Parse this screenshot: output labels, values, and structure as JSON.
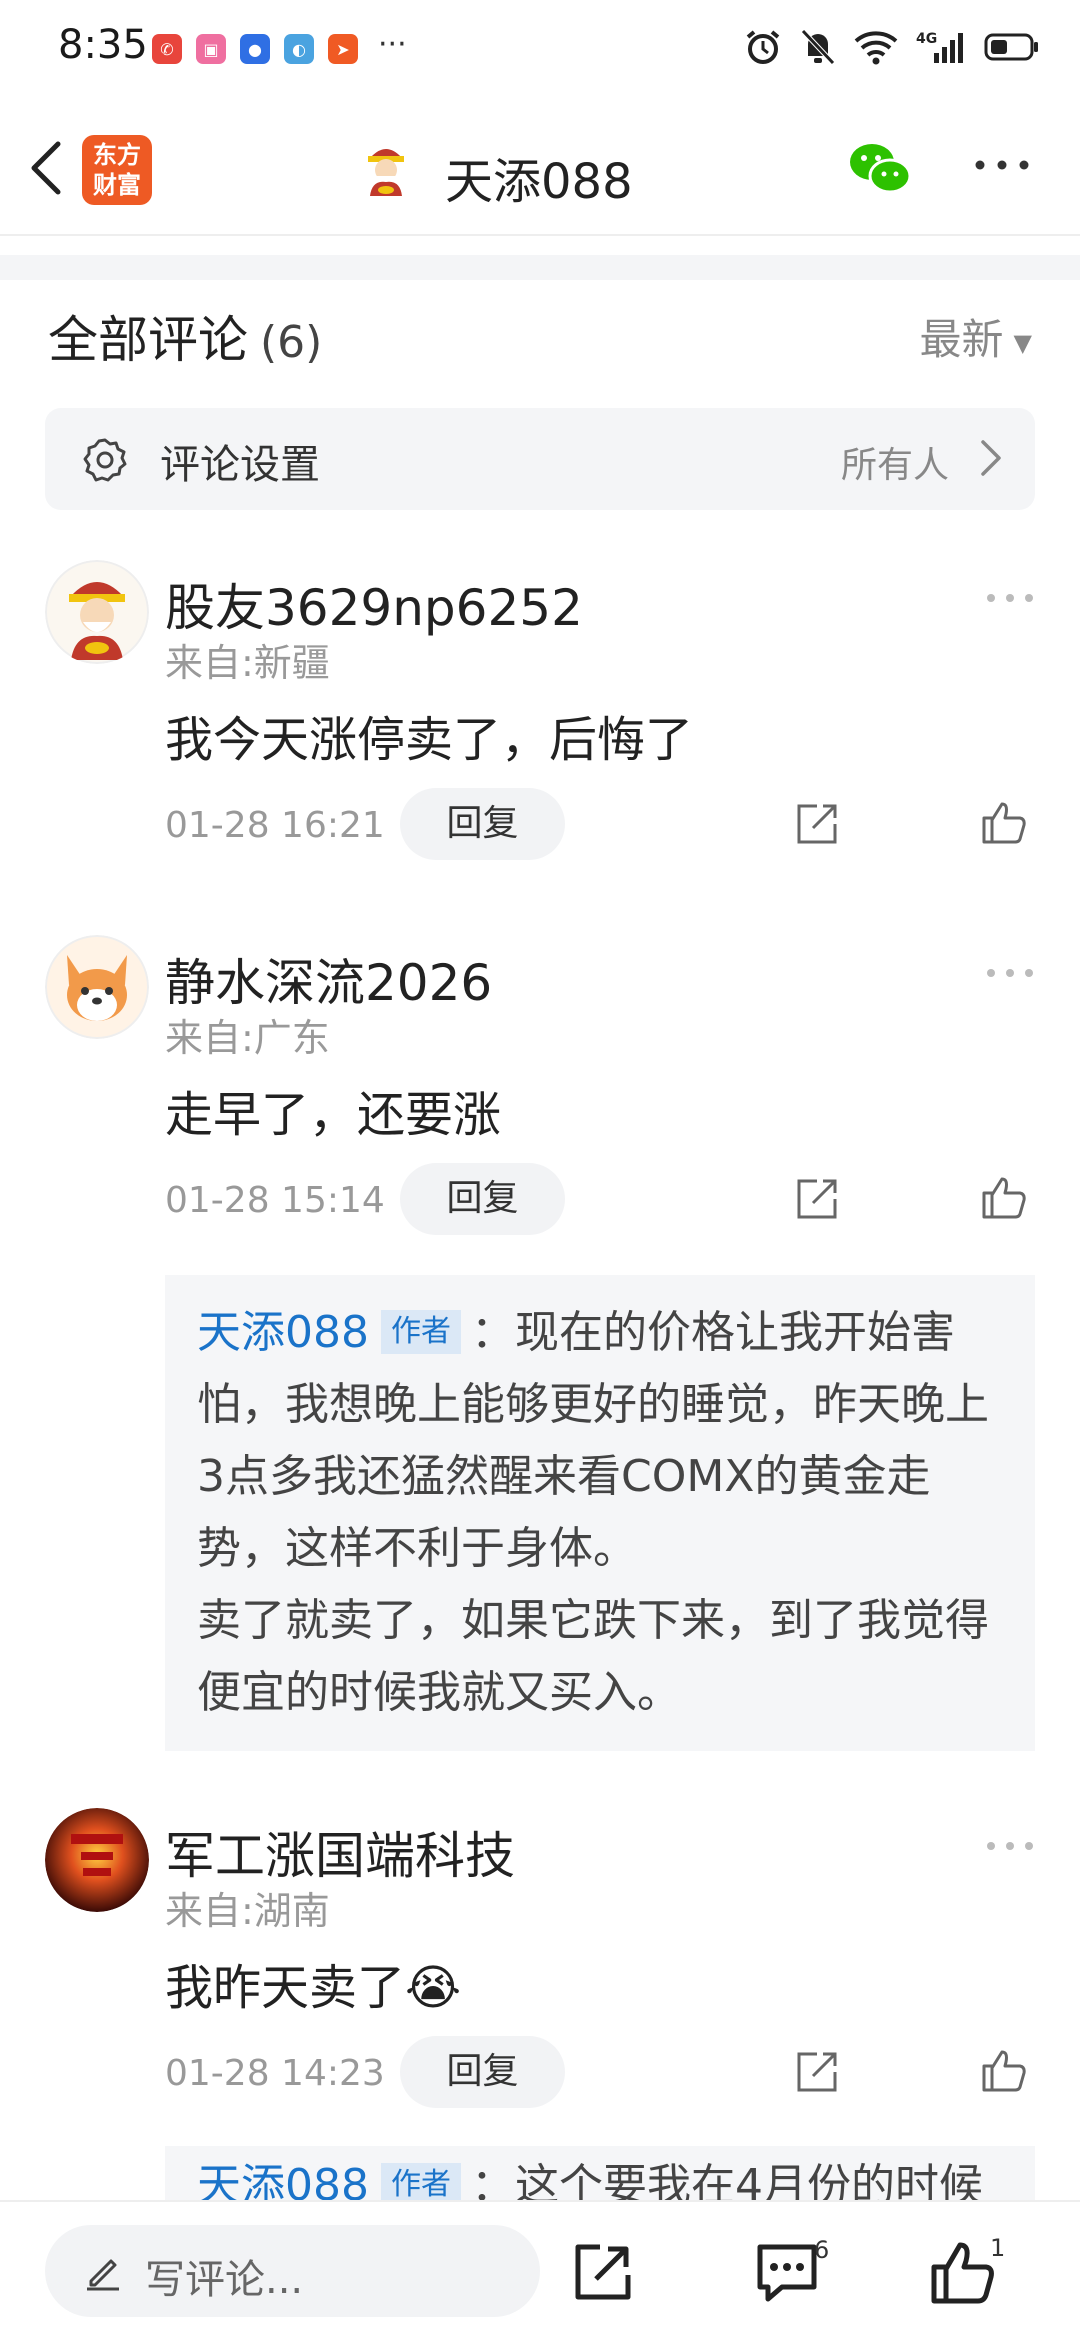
{
  "status_bar": {
    "time": "8:35",
    "more": "···",
    "network": "4G"
  },
  "nav": {
    "logo_line1": "东方",
    "logo_line2": "财富",
    "title": "天添088"
  },
  "comments_header": {
    "title": "全部评论",
    "count": "(6)",
    "sort": "最新"
  },
  "settings": {
    "label": "评论设置",
    "value": "所有人"
  },
  "comments": [
    {
      "user": "股友3629np6252",
      "location": "来自:新疆",
      "text": "我今天涨停卖了，后悔了",
      "time": "01-28 16:21",
      "reply_label": "回复"
    },
    {
      "user": "静水深流2026",
      "location": "来自:广东",
      "text": "走早了，还要涨",
      "time": "01-28 15:14",
      "reply_label": "回复",
      "reply": {
        "author": "天添088",
        "tag": "作者",
        "text": "：现在的价格让我开始害怕，我想晚上能够更好的睡觉，昨天晚上3点多我还猛然醒来看COMX的黄金走势，这样不利于身体。",
        "text2": "卖了就卖了，如果它跌下来，到了我觉得便宜的时候我就又买入。"
      }
    },
    {
      "user": "军工涨国端科技",
      "location": "来自:湖南",
      "text": "我昨天卖了😭",
      "time": "01-28 14:23",
      "reply_label": "回复",
      "reply": {
        "author": "天添088",
        "tag": "作者",
        "text": "：这个要我在4月份的时候"
      }
    }
  ],
  "bottom_bar": {
    "placeholder": "写评论...",
    "comment_count": "6",
    "like_count": "1"
  }
}
